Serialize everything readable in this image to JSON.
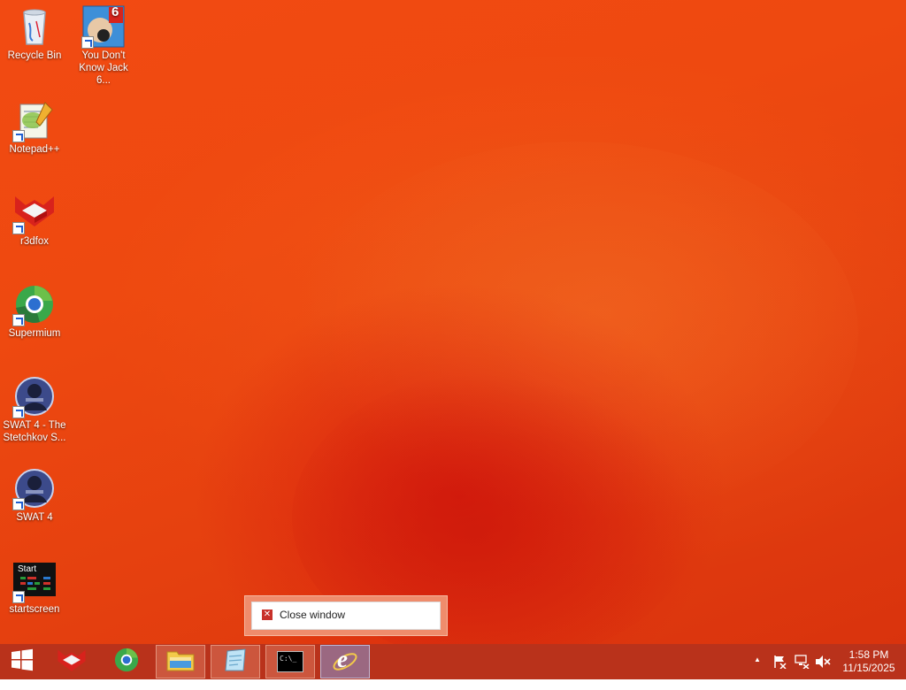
{
  "desktop_icons": [
    {
      "id": "recycle-bin",
      "label": "Recycle Bin",
      "icon": "recycle-bin-icon",
      "shortcut": false
    },
    {
      "id": "ydkj6",
      "label": "You Don't Know Jack 6...",
      "icon": "you-dont-know-jack-icon",
      "shortcut": true,
      "badge": "6"
    },
    {
      "id": "notepadpp",
      "label": "Notepad++",
      "icon": "notepad-plus-plus-icon",
      "shortcut": true
    },
    {
      "id": "r3dfox",
      "label": "r3dfox",
      "icon": "r3dfox-icon",
      "shortcut": true
    },
    {
      "id": "supermium",
      "label": "Supermium",
      "icon": "supermium-icon",
      "shortcut": true
    },
    {
      "id": "swat4-stetchkov",
      "label": "SWAT 4 - The Stetchkov S...",
      "icon": "swat4-icon",
      "shortcut": true
    },
    {
      "id": "swat4",
      "label": "SWAT 4",
      "icon": "swat4-icon",
      "shortcut": true
    },
    {
      "id": "startscreen",
      "label": "startscreen",
      "icon": "startscreen-icon",
      "shortcut": true,
      "tile_text": "Start"
    }
  ],
  "popup": {
    "close_label": "Close window",
    "x_glyph": "✕"
  },
  "taskbar": {
    "buttons": [
      {
        "id": "start",
        "icon": "windows-start-icon"
      },
      {
        "id": "r3dfox",
        "icon": "r3dfox-icon"
      },
      {
        "id": "supermium",
        "icon": "supermium-icon"
      },
      {
        "id": "file-explorer",
        "icon": "file-explorer-icon"
      },
      {
        "id": "notepad",
        "icon": "notepad-icon"
      },
      {
        "id": "cmd",
        "icon": "command-prompt-icon",
        "glyph": "C:\\_"
      },
      {
        "id": "ie",
        "icon": "internet-explorer-icon",
        "glyph": "e"
      }
    ],
    "tray": {
      "overflow_glyph": "▲",
      "clock_time": "1:58 PM",
      "clock_date": "11/15/2025"
    }
  },
  "colors": {
    "accent": "#ee4910",
    "taskbar": "#b9321b",
    "active_blue": "#3a7bd5"
  }
}
